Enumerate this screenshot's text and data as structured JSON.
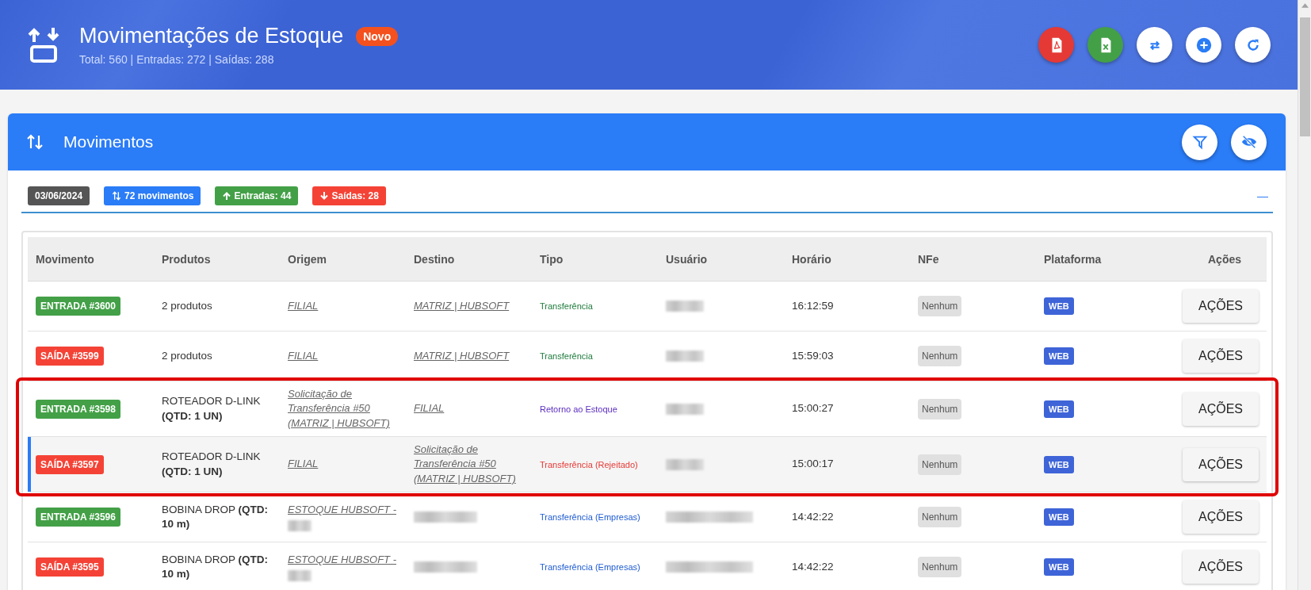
{
  "header": {
    "title": "Movimentações de Estoque",
    "badge": "Novo",
    "subtitle": "Total: 560 | Entradas: 272 | Saídas: 288",
    "actions": [
      {
        "kind": "pdf"
      },
      {
        "kind": "excel"
      },
      {
        "kind": "transfer"
      },
      {
        "kind": "add"
      },
      {
        "kind": "refresh"
      }
    ]
  },
  "card": {
    "title": "Movimentos",
    "actions": [
      {
        "kind": "filter"
      },
      {
        "kind": "hide"
      }
    ],
    "summary": [
      {
        "kind": "date",
        "text": "03/06/2024"
      },
      {
        "kind": "total",
        "text": "72 movimentos"
      },
      {
        "kind": "in",
        "text": "Entradas: 44"
      },
      {
        "kind": "out",
        "text": "Saídas: 28"
      }
    ],
    "collapse": "—"
  },
  "table": {
    "columns": [
      "Movimento",
      "Produtos",
      "Origem",
      "Destino",
      "Tipo",
      "Usuário",
      "Horário",
      "NFe",
      "Plataforma",
      "Ações"
    ],
    "rows": [
      {
        "kind": "in",
        "movement": "ENTRADA #3600",
        "product": "2 produtos",
        "origin": {
          "text": "FILIAL",
          "redacted": false
        },
        "destination": {
          "text": "MATRIZ | HUBSOFT",
          "redacted": false
        },
        "type": {
          "text": "Transferência",
          "color": "#1e7b3c"
        },
        "user_redacted": true,
        "time": "16:12:59",
        "nfe": "Nenhum",
        "platform": "WEB",
        "action": "AÇÕES",
        "selected": false,
        "highlighted": false
      },
      {
        "kind": "out",
        "movement": "SAÍDA #3599",
        "product": "2 produtos",
        "origin": {
          "text": "FILIAL",
          "redacted": false
        },
        "destination": {
          "text": "MATRIZ | HUBSOFT",
          "redacted": false
        },
        "type": {
          "text": "Transferência",
          "color": "#1e7b3c"
        },
        "user_redacted": true,
        "time": "15:59:03",
        "nfe": "Nenhum",
        "platform": "WEB",
        "action": "AÇÕES",
        "selected": false,
        "highlighted": false
      },
      {
        "kind": "in",
        "movement": "ENTRADA #3598",
        "product": "ROTEADOR D-LINK **(QTD: 1 UN)**",
        "origin": {
          "text": "Solicitação de Transferência #50 (MATRIZ | HUBSOFT)",
          "redacted": false
        },
        "destination": {
          "text": "FILIAL",
          "redacted": false
        },
        "type": {
          "text": "Retorno ao Estoque",
          "color": "#5b2dbf"
        },
        "user_redacted": true,
        "time": "15:00:27",
        "nfe": "Nenhum",
        "platform": "WEB",
        "action": "AÇÕES",
        "selected": false,
        "highlighted": true
      },
      {
        "kind": "out",
        "movement": "SAÍDA #3597",
        "product": "ROTEADOR D-LINK **(QTD: 1 UN)**",
        "origin": {
          "text": "FILIAL",
          "redacted": false
        },
        "destination": {
          "text": "Solicitação de Transferência #50 (MATRIZ | HUBSOFT)",
          "redacted": false
        },
        "type": {
          "text": "Transferência (Rejeitado)",
          "color": "#e53935"
        },
        "user_redacted": true,
        "time": "15:00:17",
        "nfe": "Nenhum",
        "platform": "WEB",
        "action": "AÇÕES",
        "selected": true,
        "highlighted": true
      },
      {
        "kind": "in",
        "movement": "ENTRADA #3596",
        "product": "BOBINA DROP **(QTD: 10 m)**",
        "origin": {
          "text": "ESTOQUE HUBSOFT -",
          "redacted": true
        },
        "destination": {
          "redacted": true
        },
        "type": {
          "text": "Transferência (Empresas)",
          "color": "#1e5bd0"
        },
        "user_redacted": true,
        "time": "14:42:22",
        "nfe": "Nenhum",
        "platform": "WEB",
        "action": "AÇÕES",
        "selected": false,
        "highlighted": false
      },
      {
        "kind": "out",
        "movement": "SAÍDA #3595",
        "product": "BOBINA DROP **(QTD: 10 m)**",
        "origin": {
          "text": "ESTOQUE HUBSOFT -",
          "redacted": true
        },
        "destination": {
          "redacted": true
        },
        "type": {
          "text": "Transferência (Empresas)",
          "color": "#1e5bd0"
        },
        "user_redacted": true,
        "time": "14:42:22",
        "nfe": "Nenhum",
        "platform": "WEB",
        "action": "AÇÕES",
        "selected": false,
        "highlighted": false
      }
    ]
  }
}
